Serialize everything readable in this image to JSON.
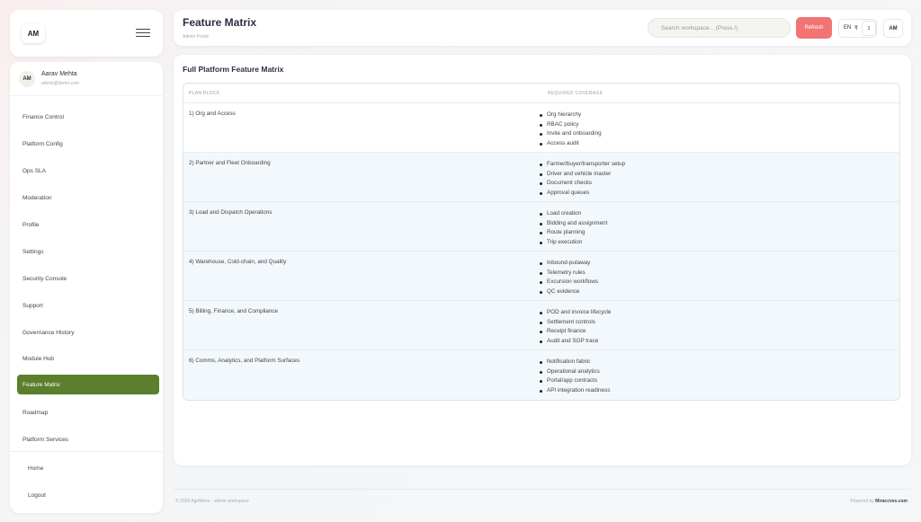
{
  "brand": {
    "logo_text": "AM"
  },
  "user": {
    "initials": "AM",
    "name": "Aarav Mehta",
    "email": "admin@demo.com"
  },
  "sidebar": {
    "items": [
      {
        "label": "Finance Control"
      },
      {
        "label": "Platform Config"
      },
      {
        "label": "Ops SLA"
      },
      {
        "label": "Moderation"
      },
      {
        "label": "Profile"
      },
      {
        "label": "Settings"
      },
      {
        "label": "Security Console"
      },
      {
        "label": "Support"
      },
      {
        "label": "Governance History"
      },
      {
        "label": "Module Hub"
      },
      {
        "label": "Feature Matrix",
        "active": true
      },
      {
        "label": "Roadmap"
      },
      {
        "label": "Platform Services"
      }
    ],
    "bottom_items": [
      {
        "label": "Home"
      },
      {
        "label": "Logout"
      }
    ]
  },
  "header": {
    "title": "Feature Matrix",
    "subtitle": "Admin Portal",
    "search_placeholder": "Search workspace... (Press /)",
    "refresh_label": "Refresh",
    "lang": "EN",
    "currency": "₹",
    "notif_count": "1",
    "user_initials": "AM"
  },
  "main": {
    "section_title": "Full Platform Feature Matrix",
    "columns": [
      "PLAN BLOCK",
      "REQUIRED COVERAGE"
    ],
    "rows": [
      {
        "block": "1) Org and Access",
        "coverage": [
          "Org hierarchy",
          "RBAC policy",
          "Invite and onboarding",
          "Access audit"
        ]
      },
      {
        "block": "2) Partner and Fleet Onboarding",
        "coverage": [
          "Farmer/buyer/transporter setup",
          "Driver and vehicle master",
          "Document checks",
          "Approval queues"
        ]
      },
      {
        "block": "3) Load and Dispatch Operations",
        "coverage": [
          "Load creation",
          "Bidding and assignment",
          "Route planning",
          "Trip execution"
        ]
      },
      {
        "block": "4) Warehouse, Cold-chain, and Quality",
        "coverage": [
          "Inbound-putaway",
          "Telemetry rules",
          "Excursion workflows",
          "QC evidence"
        ]
      },
      {
        "block": "5) Billing, Finance, and Compliance",
        "coverage": [
          "POD and invoice lifecycle",
          "Settlement controls",
          "Receipt finance",
          "Audit and SOP trace"
        ]
      },
      {
        "block": "6) Comms, Analytics, and Platform Surfaces",
        "coverage": [
          "Notification fabric",
          "Operational analytics",
          "Portal/app contracts",
          "API integration readiness"
        ]
      }
    ]
  },
  "footer": {
    "left": "© 2026 AgriMove · admin workspace",
    "right_prefix": "Powered by",
    "right_brand": "Miraccves.com"
  },
  "colors": {
    "accent": "#5b7f2c",
    "refresh": "#f27474",
    "title": "#2a2e45"
  }
}
